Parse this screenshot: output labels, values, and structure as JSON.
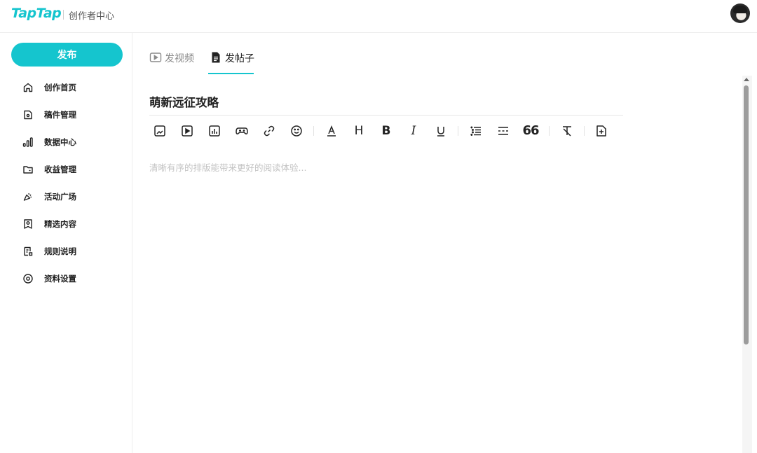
{
  "header": {
    "brand": "TapTap",
    "subtitle": "创作者中心",
    "avatar_icon": "user-avatar"
  },
  "sidebar": {
    "publish_label": "发布",
    "items": [
      {
        "label": "创作首页",
        "icon": "home-icon"
      },
      {
        "label": "稿件管理",
        "icon": "manuscript-icon"
      },
      {
        "label": "数据中心",
        "icon": "bar-chart-icon"
      },
      {
        "label": "收益管理",
        "icon": "folder-icon"
      },
      {
        "label": "活动广场",
        "icon": "megaphone-icon"
      },
      {
        "label": "精选内容",
        "icon": "featured-icon"
      },
      {
        "label": "规则说明",
        "icon": "rules-doc-icon"
      },
      {
        "label": "资料设置",
        "icon": "settings-icon"
      }
    ]
  },
  "tabs": [
    {
      "label": "发视频",
      "icon": "video-icon",
      "active": false
    },
    {
      "label": "发帖子",
      "icon": "document-icon",
      "active": true
    }
  ],
  "editor": {
    "title": "萌新远征攻略",
    "placeholder": "清晰有序的排版能带来更好的阅读体验...",
    "toolbar": [
      "image-icon",
      "video-icon",
      "chart-icon",
      "gamepad-icon",
      "link-icon",
      "emoji-icon",
      "font-color-icon",
      "heading-icon",
      "bold-icon",
      "italic-icon",
      "underline-icon",
      "bullet-list-icon",
      "divider-icon",
      "quote-icon",
      "clear-format-icon",
      "insert-icon"
    ]
  },
  "colors": {
    "accent": "#15c5ce"
  }
}
